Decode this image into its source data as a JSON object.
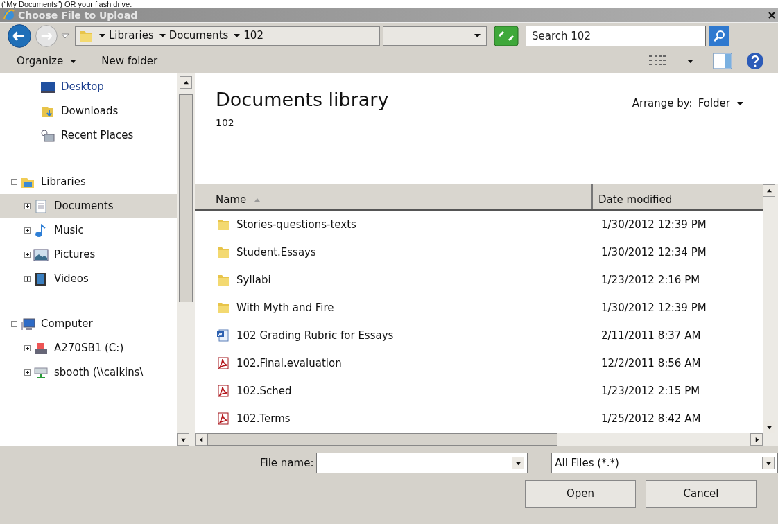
{
  "page_text": "(“My Documents”) OR your flash drive.",
  "window": {
    "title": "Choose File to Upload"
  },
  "address": {
    "crumbs": [
      "Libraries",
      "Documents",
      "102"
    ]
  },
  "search": {
    "placeholder": "Search 102"
  },
  "toolbar": {
    "buttons": [
      {
        "label": "Organize",
        "has_menu": true
      },
      {
        "label": "New folder",
        "has_menu": false
      }
    ]
  },
  "nav": {
    "favorites": [
      {
        "label": "Desktop",
        "kind": "desktop",
        "hovered": true
      },
      {
        "label": "Downloads",
        "kind": "downloads",
        "hovered": false
      },
      {
        "label": "Recent Places",
        "kind": "recent",
        "hovered": false
      }
    ],
    "tree": [
      {
        "label": "Libraries",
        "kind": "library",
        "expanded": true,
        "selected": false,
        "children": [
          {
            "label": "Documents",
            "kind": "documents",
            "expanded": false,
            "selected": true
          },
          {
            "label": "Music",
            "kind": "music",
            "expanded": false,
            "selected": false
          },
          {
            "label": "Pictures",
            "kind": "pictures",
            "expanded": false,
            "selected": false
          },
          {
            "label": "Videos",
            "kind": "videos",
            "expanded": false,
            "selected": false
          }
        ]
      },
      {
        "label": "Computer",
        "kind": "computer",
        "expanded": true,
        "selected": false,
        "children": [
          {
            "label": "A270SB1 (C:)",
            "kind": "drive",
            "expanded": false,
            "selected": false
          },
          {
            "label": "sbooth (\\\\calkins\\",
            "kind": "network",
            "expanded": false,
            "selected": false
          }
        ]
      }
    ]
  },
  "library": {
    "title": "Documents library",
    "subtitle": "102",
    "arrange_label": "Arrange by:",
    "arrange_value": "Folder"
  },
  "table": {
    "columns": [
      {
        "label": "Name",
        "sorted": true
      },
      {
        "label": "Date modified",
        "sorted": false
      }
    ],
    "rows": [
      {
        "name": "Stories-questions-texts",
        "kind": "folder",
        "date": "1/30/2012 12:39 PM"
      },
      {
        "name": "Student.Essays",
        "kind": "folder",
        "date": "1/30/2012 12:34 PM"
      },
      {
        "name": "Syllabi",
        "kind": "folder",
        "date": "1/23/2012 2:16 PM"
      },
      {
        "name": "With Myth and Fire",
        "kind": "folder",
        "date": "1/30/2012 12:39 PM"
      },
      {
        "name": "102 Grading Rubric for Essays",
        "kind": "word",
        "date": "2/11/2011 8:37 AM"
      },
      {
        "name": "102.Final.evaluation",
        "kind": "pdf",
        "date": "12/2/2011 8:56 AM"
      },
      {
        "name": "102.Sched",
        "kind": "pdf",
        "date": "1/23/2012 2:15 PM"
      },
      {
        "name": "102.Terms",
        "kind": "pdf",
        "date": "1/25/2012 8:42 AM"
      }
    ]
  },
  "footer": {
    "file_name_label": "File name:",
    "filter": "All Files (*.*)",
    "buttons": [
      "Open",
      "Cancel"
    ]
  }
}
